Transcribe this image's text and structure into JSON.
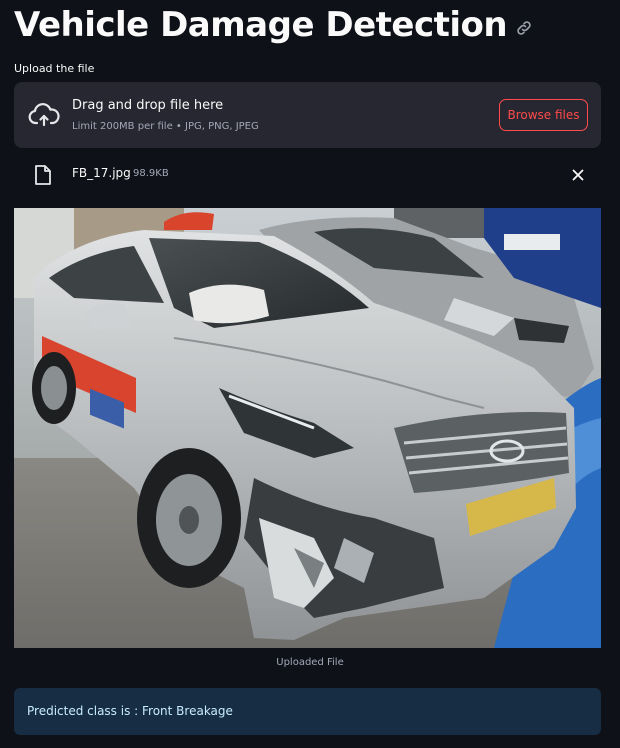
{
  "header": {
    "title": "Vehicle Damage Detection"
  },
  "uploader": {
    "label": "Upload the file",
    "drop_title": "Drag and drop file here",
    "limit_text": "Limit 200MB per file • JPG, PNG, JPEG",
    "browse_label": "Browse files"
  },
  "file": {
    "name": "FB_17.jpg",
    "size": "98.9KB"
  },
  "image": {
    "caption": "Uploaded File"
  },
  "result": {
    "text": "Predicted class is : Front Breakage"
  },
  "colors": {
    "background": "#0e1117",
    "panel": "#262730",
    "accent": "#ff4b4b",
    "info_bg": "#172d43",
    "info_text": "#c7ebff"
  }
}
